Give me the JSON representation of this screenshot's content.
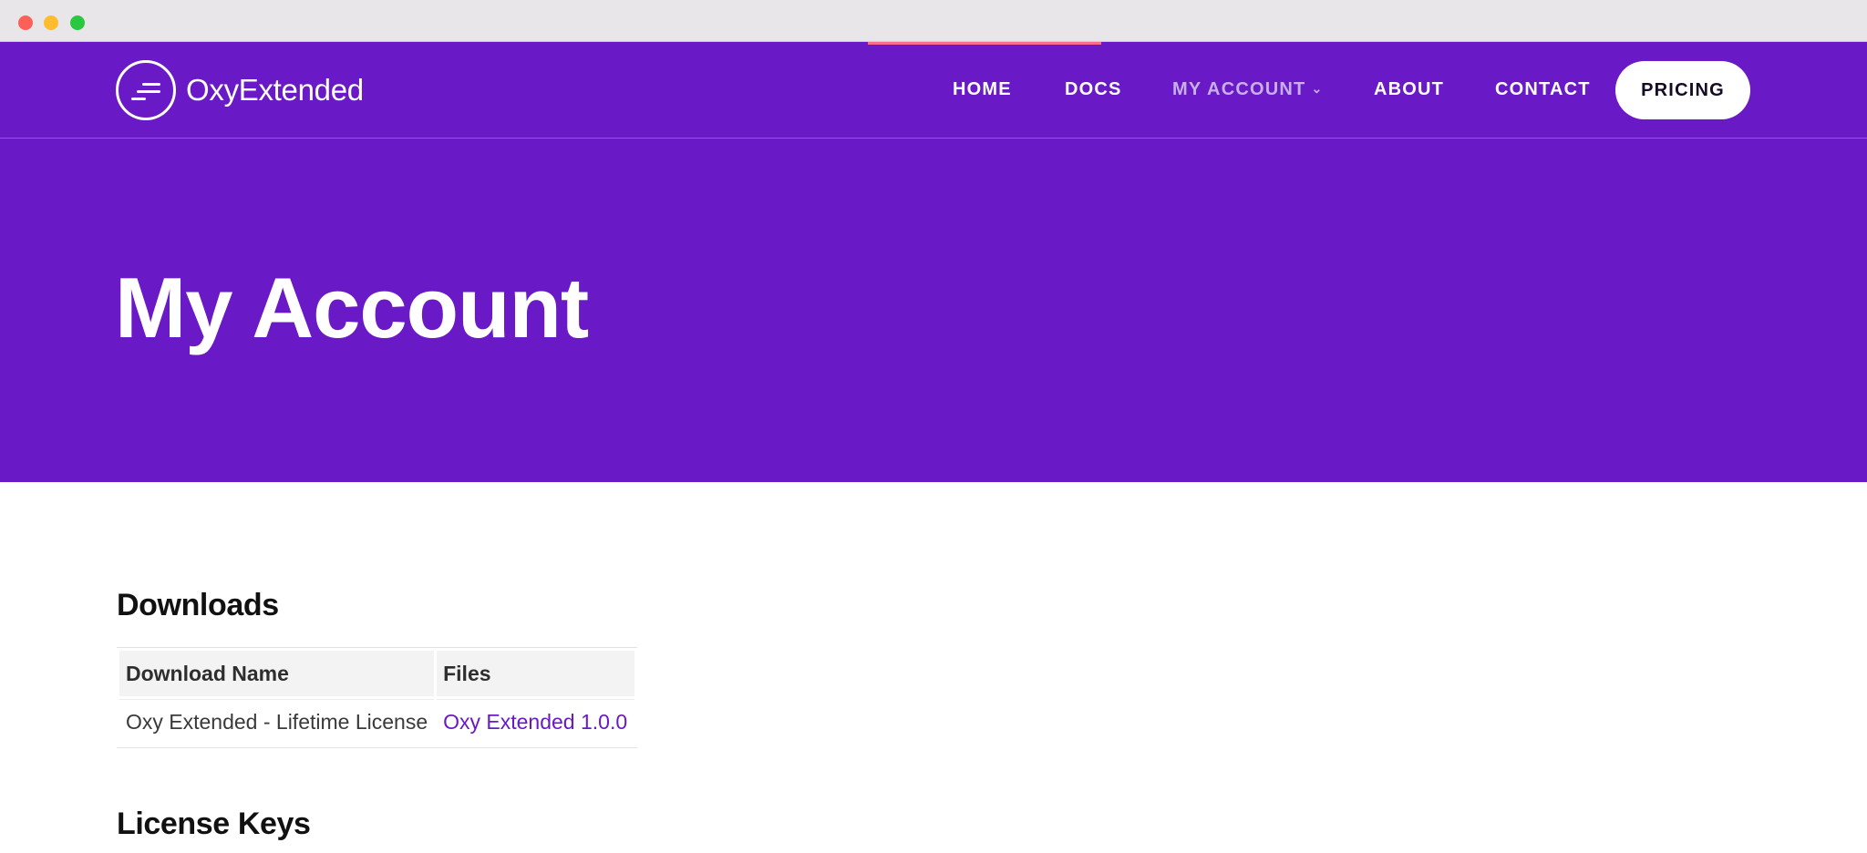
{
  "brand": {
    "name": "OxyExtended",
    "icon": "logo-mark-icon"
  },
  "nav": {
    "items": [
      {
        "label": "HOME"
      },
      {
        "label": "DOCS"
      },
      {
        "label": "MY ACCOUNT",
        "has_dropdown": true,
        "active": true
      },
      {
        "label": "ABOUT"
      },
      {
        "label": "CONTACT"
      }
    ],
    "cta": "PRICING"
  },
  "hero": {
    "title": "My Account"
  },
  "downloads": {
    "title": "Downloads",
    "columns": [
      "Download Name",
      "Files"
    ],
    "rows": [
      {
        "name": "Oxy Extended - Lifetime License",
        "file": "Oxy Extended 1.0.0"
      }
    ]
  },
  "license_keys": {
    "title": "License Keys"
  },
  "colors": {
    "brand_purple": "#6a19c6",
    "accent_bar": "#ff6b8a",
    "cta_bg": "#ffffff"
  }
}
